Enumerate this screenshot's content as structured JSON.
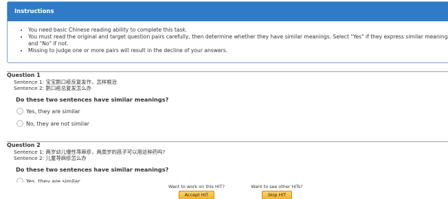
{
  "instructions": {
    "title": "Instructions",
    "items": [
      "You need basic Chinese reading ability to complete this task.",
      "You must read the original and target question pairs carefully, then determine whether they have similar meanings. Select \"Yes\" if they express similar meanings, and \"No\" if not.",
      "Missing to judge one or more pairs will result in the decline of your answers."
    ]
  },
  "questions": [
    {
      "title": "Question 1",
      "sentence1": "Sentence 1: 宝宝鹅口疮反复发作，怎样根治",
      "sentence2": "Sentence 2: 鹅口疮总复发怎么办",
      "prompt": "Do these two sentences have similar meanings?",
      "options": [
        "Yes, they are similar",
        "No, they are not similar"
      ]
    },
    {
      "title": "Question 2",
      "sentence1": "Sentence 1: 两岁幼儿慢性荨麻疹，两周岁的孩子可以用这种药吗?",
      "sentence2": "Sentence 2: 儿童荨麻疹怎么办",
      "prompt": "Do these two sentences have similar meanings?",
      "options": [
        "Yes, they are similar"
      ]
    }
  ],
  "footer": {
    "accept_prompt": "Want to work on this HIT?",
    "accept_label": "Accept HIT",
    "skip_prompt": "Want to see other HITs?",
    "skip_label": "Skip HIT"
  }
}
